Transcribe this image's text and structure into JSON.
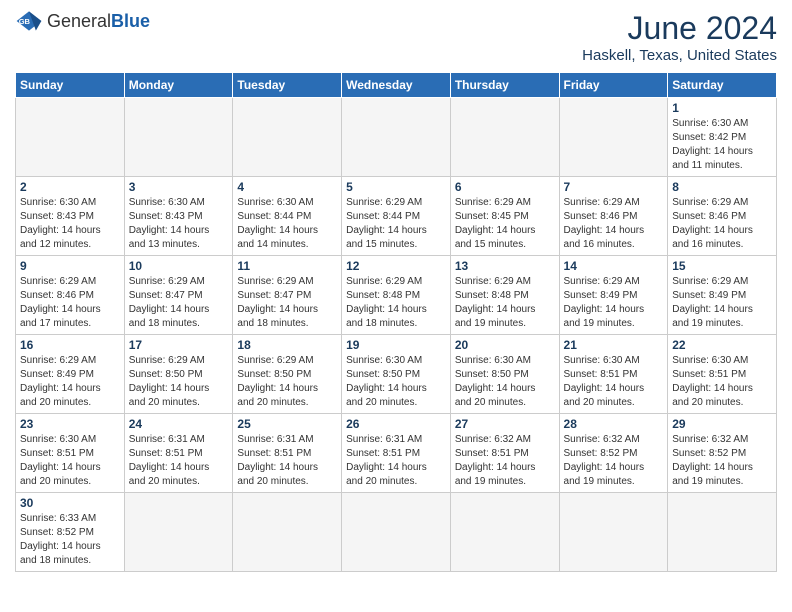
{
  "logo": {
    "general": "General",
    "blue": "Blue"
  },
  "title": {
    "month_year": "June 2024",
    "location": "Haskell, Texas, United States"
  },
  "days_of_week": [
    "Sunday",
    "Monday",
    "Tuesday",
    "Wednesday",
    "Thursday",
    "Friday",
    "Saturday"
  ],
  "weeks": [
    [
      {
        "day": "",
        "info": ""
      },
      {
        "day": "",
        "info": ""
      },
      {
        "day": "",
        "info": ""
      },
      {
        "day": "",
        "info": ""
      },
      {
        "day": "",
        "info": ""
      },
      {
        "day": "",
        "info": ""
      },
      {
        "day": "1",
        "info": "Sunrise: 6:30 AM\nSunset: 8:42 PM\nDaylight: 14 hours and 11 minutes."
      }
    ],
    [
      {
        "day": "2",
        "info": "Sunrise: 6:30 AM\nSunset: 8:43 PM\nDaylight: 14 hours and 12 minutes."
      },
      {
        "day": "3",
        "info": "Sunrise: 6:30 AM\nSunset: 8:43 PM\nDaylight: 14 hours and 13 minutes."
      },
      {
        "day": "4",
        "info": "Sunrise: 6:30 AM\nSunset: 8:44 PM\nDaylight: 14 hours and 14 minutes."
      },
      {
        "day": "5",
        "info": "Sunrise: 6:29 AM\nSunset: 8:44 PM\nDaylight: 14 hours and 15 minutes."
      },
      {
        "day": "6",
        "info": "Sunrise: 6:29 AM\nSunset: 8:45 PM\nDaylight: 14 hours and 15 minutes."
      },
      {
        "day": "7",
        "info": "Sunrise: 6:29 AM\nSunset: 8:46 PM\nDaylight: 14 hours and 16 minutes."
      },
      {
        "day": "8",
        "info": "Sunrise: 6:29 AM\nSunset: 8:46 PM\nDaylight: 14 hours and 16 minutes."
      }
    ],
    [
      {
        "day": "9",
        "info": "Sunrise: 6:29 AM\nSunset: 8:46 PM\nDaylight: 14 hours and 17 minutes."
      },
      {
        "day": "10",
        "info": "Sunrise: 6:29 AM\nSunset: 8:47 PM\nDaylight: 14 hours and 18 minutes."
      },
      {
        "day": "11",
        "info": "Sunrise: 6:29 AM\nSunset: 8:47 PM\nDaylight: 14 hours and 18 minutes."
      },
      {
        "day": "12",
        "info": "Sunrise: 6:29 AM\nSunset: 8:48 PM\nDaylight: 14 hours and 18 minutes."
      },
      {
        "day": "13",
        "info": "Sunrise: 6:29 AM\nSunset: 8:48 PM\nDaylight: 14 hours and 19 minutes."
      },
      {
        "day": "14",
        "info": "Sunrise: 6:29 AM\nSunset: 8:49 PM\nDaylight: 14 hours and 19 minutes."
      },
      {
        "day": "15",
        "info": "Sunrise: 6:29 AM\nSunset: 8:49 PM\nDaylight: 14 hours and 19 minutes."
      }
    ],
    [
      {
        "day": "16",
        "info": "Sunrise: 6:29 AM\nSunset: 8:49 PM\nDaylight: 14 hours and 20 minutes."
      },
      {
        "day": "17",
        "info": "Sunrise: 6:29 AM\nSunset: 8:50 PM\nDaylight: 14 hours and 20 minutes."
      },
      {
        "day": "18",
        "info": "Sunrise: 6:29 AM\nSunset: 8:50 PM\nDaylight: 14 hours and 20 minutes."
      },
      {
        "day": "19",
        "info": "Sunrise: 6:30 AM\nSunset: 8:50 PM\nDaylight: 14 hours and 20 minutes."
      },
      {
        "day": "20",
        "info": "Sunrise: 6:30 AM\nSunset: 8:50 PM\nDaylight: 14 hours and 20 minutes."
      },
      {
        "day": "21",
        "info": "Sunrise: 6:30 AM\nSunset: 8:51 PM\nDaylight: 14 hours and 20 minutes."
      },
      {
        "day": "22",
        "info": "Sunrise: 6:30 AM\nSunset: 8:51 PM\nDaylight: 14 hours and 20 minutes."
      }
    ],
    [
      {
        "day": "23",
        "info": "Sunrise: 6:30 AM\nSunset: 8:51 PM\nDaylight: 14 hours and 20 minutes."
      },
      {
        "day": "24",
        "info": "Sunrise: 6:31 AM\nSunset: 8:51 PM\nDaylight: 14 hours and 20 minutes."
      },
      {
        "day": "25",
        "info": "Sunrise: 6:31 AM\nSunset: 8:51 PM\nDaylight: 14 hours and 20 minutes."
      },
      {
        "day": "26",
        "info": "Sunrise: 6:31 AM\nSunset: 8:51 PM\nDaylight: 14 hours and 20 minutes."
      },
      {
        "day": "27",
        "info": "Sunrise: 6:32 AM\nSunset: 8:51 PM\nDaylight: 14 hours and 19 minutes."
      },
      {
        "day": "28",
        "info": "Sunrise: 6:32 AM\nSunset: 8:52 PM\nDaylight: 14 hours and 19 minutes."
      },
      {
        "day": "29",
        "info": "Sunrise: 6:32 AM\nSunset: 8:52 PM\nDaylight: 14 hours and 19 minutes."
      }
    ],
    [
      {
        "day": "30",
        "info": "Sunrise: 6:33 AM\nSunset: 8:52 PM\nDaylight: 14 hours and 18 minutes."
      },
      {
        "day": "",
        "info": ""
      },
      {
        "day": "",
        "info": ""
      },
      {
        "day": "",
        "info": ""
      },
      {
        "day": "",
        "info": ""
      },
      {
        "day": "",
        "info": ""
      },
      {
        "day": "",
        "info": ""
      }
    ]
  ]
}
